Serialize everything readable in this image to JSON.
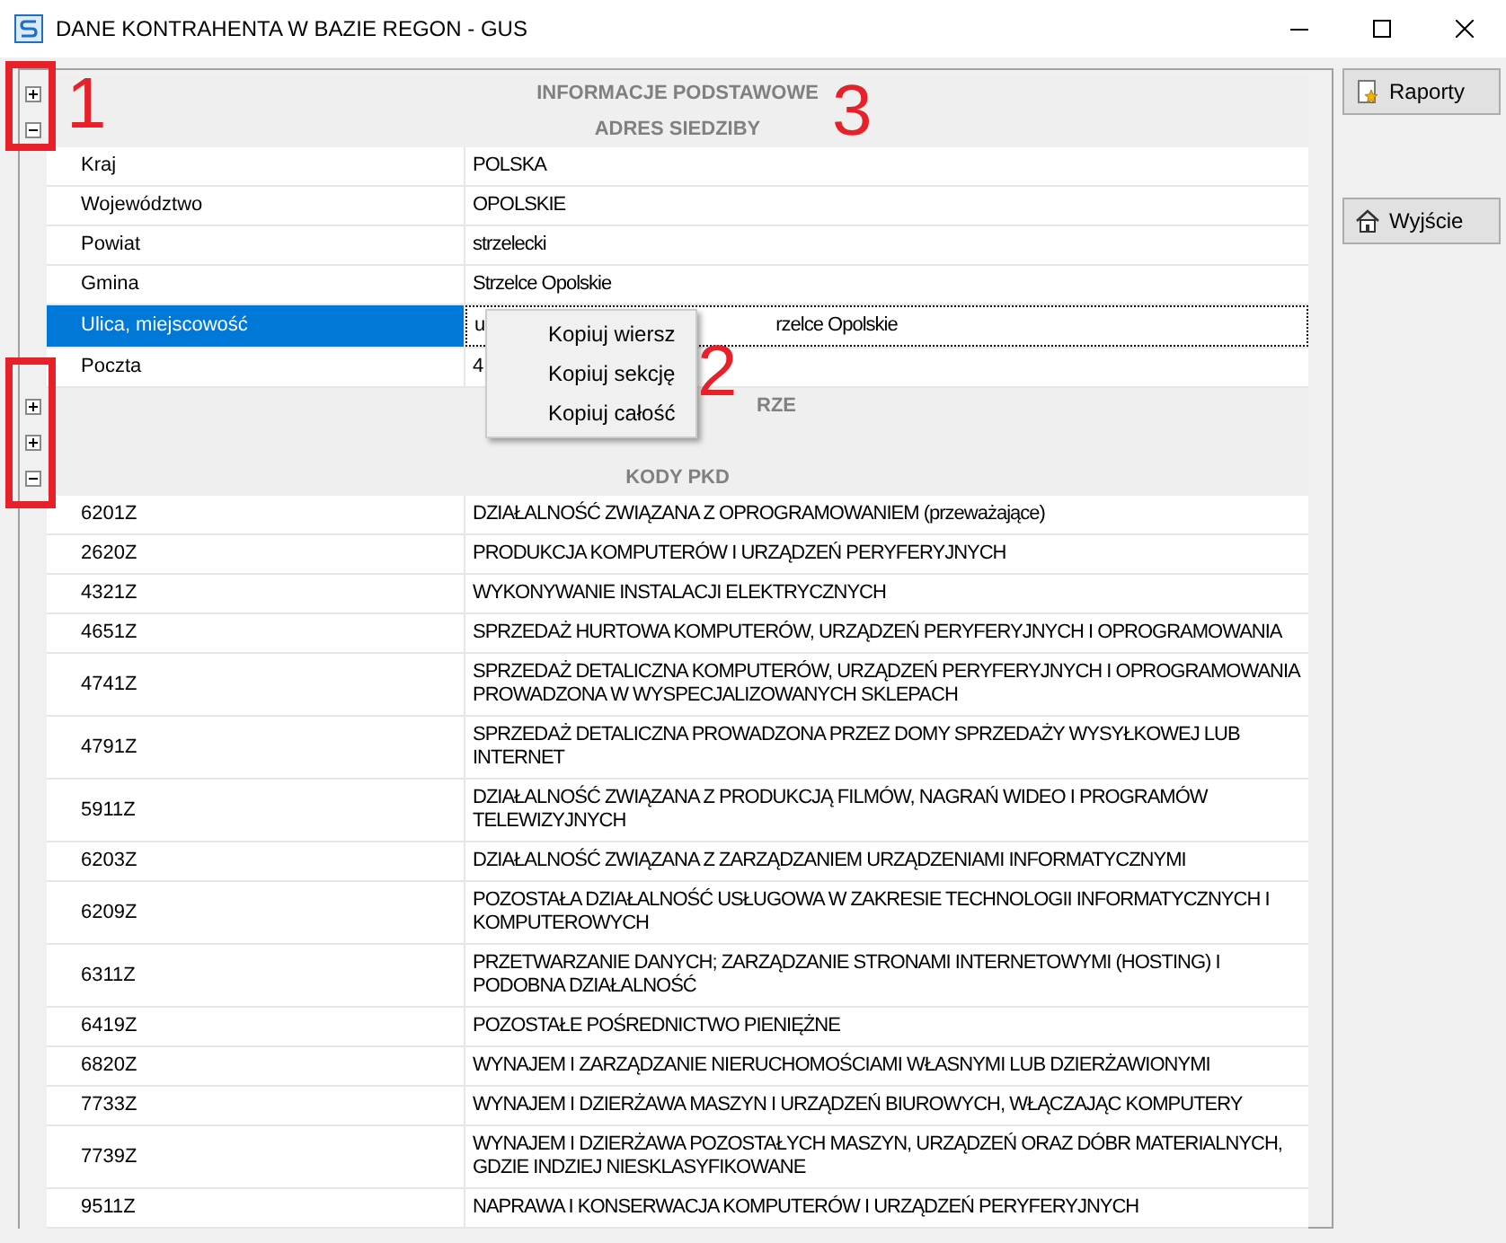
{
  "window": {
    "title": "DANE KONTRAHENTA W BAZIE REGON - GUS"
  },
  "sections": [
    {
      "title": "INFORMACJE PODSTAWOWE",
      "expanded": false,
      "kind": "full"
    },
    {
      "title": "ADRES SIEDZIBY",
      "expanded": true,
      "kind": "full",
      "rows": [
        {
          "key": "Kraj",
          "value": "POLSKA",
          "selected": false
        },
        {
          "key": "Województwo",
          "value": "OPOLSKIE",
          "selected": false
        },
        {
          "key": "Powiat",
          "value": "strzelecki",
          "selected": false
        },
        {
          "key": "Gmina",
          "value": "Strzelce Opolskie",
          "selected": false
        },
        {
          "key": "Ulica, miejscowość",
          "value": "u",
          "value_end": "rzelce Opolskie",
          "selected": true
        },
        {
          "key": "Poczta",
          "value": "4",
          "selected": false
        }
      ]
    },
    {
      "title": "RZE",
      "expanded": false,
      "kind": "cut"
    },
    {
      "expanded": false,
      "kind": "hidden"
    },
    {
      "title": "KODY PKD",
      "expanded": true,
      "kind": "full",
      "rows": [
        {
          "key": "6201Z",
          "value": "DZIAŁALNOŚĆ ZWIĄZANA Z OPROGRAMOWANIEM (przeważające)",
          "selected": false
        },
        {
          "key": "2620Z",
          "value": "PRODUKCJA KOMPUTERÓW I URZĄDZEŃ PERYFERYJNYCH",
          "selected": false
        },
        {
          "key": "4321Z",
          "value": "WYKONYWANIE INSTALACJI ELEKTRYCZNYCH",
          "selected": false
        },
        {
          "key": "4651Z",
          "value": "SPRZEDAŻ HURTOWA KOMPUTERÓW, URZĄDZEŃ PERYFERYJNYCH I OPROGRAMOWANIA",
          "selected": false
        },
        {
          "key": "4741Z",
          "value": "SPRZEDAŻ DETALICZNA KOMPUTERÓW, URZĄDZEŃ PERYFERYJNYCH I OPROGRAMOWANIA PROWADZONA W WYSPECJALIZOWANYCH SKLEPACH",
          "selected": false
        },
        {
          "key": "4791Z",
          "value": "SPRZEDAŻ DETALICZNA PROWADZONA PRZEZ DOMY SPRZEDAŻY WYSYŁKOWEJ LUB INTERNET",
          "selected": false
        },
        {
          "key": "5911Z",
          "value": "DZIAŁALNOŚĆ ZWIĄZANA Z PRODUKCJĄ FILMÓW, NAGRAŃ WIDEO I PROGRAMÓW TELEWIZYJNYCH",
          "selected": false
        },
        {
          "key": "6203Z",
          "value": "DZIAŁALNOŚĆ ZWIĄZANA Z ZARZĄDZANIEM URZĄDZENIAMI INFORMATYCZNYMI",
          "selected": false
        },
        {
          "key": "6209Z",
          "value": "POZOSTAŁA DZIAŁALNOŚĆ USŁUGOWA W ZAKRESIE TECHNOLOGII INFORMATYCZNYCH I KOMPUTEROWYCH",
          "selected": false
        },
        {
          "key": "6311Z",
          "value": "PRZETWARZANIE DANYCH; ZARZĄDZANIE STRONAMI INTERNETOWYMI (HOSTING) I PODOBNA DZIAŁALNOŚĆ",
          "selected": false
        },
        {
          "key": "6419Z",
          "value": "POZOSTAŁE POŚREDNICTWO PIENIĘŻNE",
          "selected": false
        },
        {
          "key": "6820Z",
          "value": "WYNAJEM I ZARZĄDZANIE NIERUCHOMOŚCIAMI WŁASNYMI LUB DZIERŻAWIONYMI",
          "selected": false
        },
        {
          "key": "7733Z",
          "value": "WYNAJEM I DZIERŻAWA MASZYN I URZĄDZEŃ BIUROWYCH, WŁĄCZAJĄC KOMPUTERY",
          "selected": false
        },
        {
          "key": "7739Z",
          "value": "WYNAJEM I DZIERŻAWA POZOSTAŁYCH MASZYN, URZĄDZEŃ ORAZ DÓBR MATERIALNYCH, GDZIE INDZIEJ NIESKLASYFIKOWANE",
          "selected": false
        },
        {
          "key": "9511Z",
          "value": "NAPRAWA I KONSERWACJA KOMPUTERÓW I URZĄDZEŃ PERYFERYJNYCH",
          "selected": false
        }
      ]
    }
  ],
  "context_menu": [
    "Kopiuj wiersz",
    "Kopiuj sekcję",
    "Kopiuj całość"
  ],
  "buttons": [
    {
      "label": "Raporty",
      "kind": "report"
    },
    {
      "label": "Wyjście",
      "kind": "home"
    }
  ],
  "annotations": [
    {
      "label": "1"
    },
    {
      "label": "2"
    },
    {
      "label": "3"
    }
  ]
}
